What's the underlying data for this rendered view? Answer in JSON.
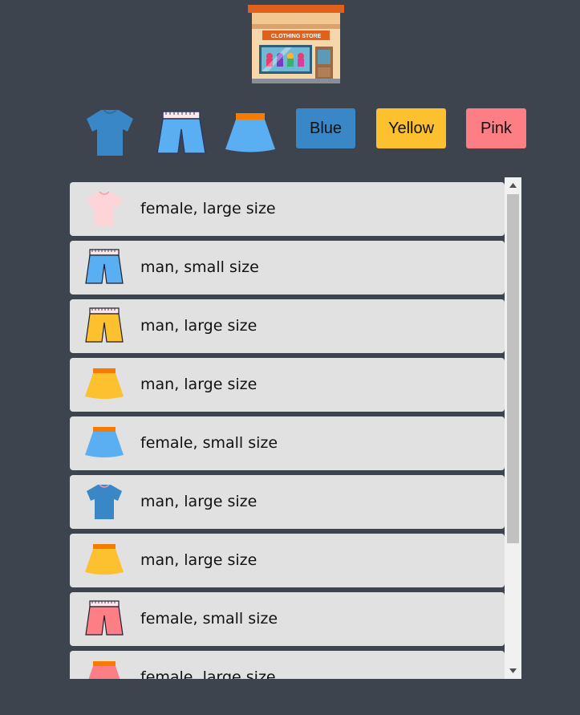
{
  "store": {
    "sign_text": "CLOTHING STORE"
  },
  "filters": {
    "color_buttons": [
      {
        "label": "Blue",
        "color": "#3a87c8"
      },
      {
        "label": "Yellow",
        "color": "#fdc02f"
      },
      {
        "label": "Pink",
        "color": "#fd7e84"
      }
    ]
  },
  "items": [
    {
      "type": "tshirt",
      "color": "#fdd5d8",
      "label": "female, large size"
    },
    {
      "type": "pants",
      "color": "#5aaef2",
      "label": "man, small size"
    },
    {
      "type": "pants",
      "color": "#fdc02f",
      "label": "man, large size"
    },
    {
      "type": "skirt",
      "color": "#fdc02f",
      "label": "man, large size"
    },
    {
      "type": "skirt",
      "color": "#5aaef2",
      "label": "female, small size"
    },
    {
      "type": "tshirt",
      "color": "#3a87c8",
      "label": "man, large size"
    },
    {
      "type": "skirt",
      "color": "#fdc02f",
      "label": "man, large size"
    },
    {
      "type": "pants",
      "color": "#fd7e84",
      "label": "female, small size"
    },
    {
      "type": "skirt",
      "color": "#fd7e84",
      "label": "female, large size"
    }
  ]
}
